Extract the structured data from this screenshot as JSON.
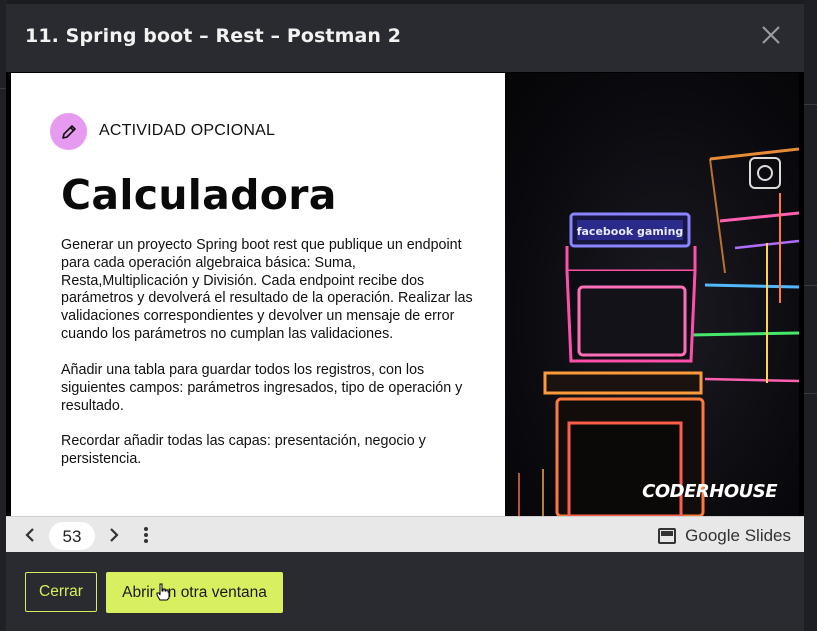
{
  "modal": {
    "title": "11. Spring boot – Rest – Postman 2",
    "close_icon": "close-icon"
  },
  "slide": {
    "activity_icon": "pencil-icon",
    "activity_label": "ACTIVIDAD OPCIONAL",
    "title": "Calculadora",
    "paragraphs": [
      "Generar un proyecto Spring boot rest que publique un endpoint para cada operación algebraica básica: Suma, Resta,Multiplicación y División. Cada endpoint recibe dos parámetros y devolverá el resultado de la operación. Realizar las validaciones correspondientes y devolver un mensaje de error cuando los parámetros no cumplan las validaciones.",
      "Añadir una tabla para guardar todos los registros, con los siguientes campos: parámetros ingresados, tipo de operación y resultado.",
      "Recordar añadir todas las capas: presentación, negocio y persistencia."
    ],
    "image_marquee": "facebook gaming",
    "brand": "CODERHOUSE"
  },
  "toolbar": {
    "page_number": "53",
    "provider_label": "Google Slides",
    "prev_icon": "chevron-left-icon",
    "next_icon": "chevron-right-icon",
    "more_icon": "more-vertical-icon"
  },
  "footer": {
    "close_label": "Cerrar",
    "open_label": "Abrir en otra ventana"
  },
  "colors": {
    "accent": "#d8f05f",
    "modal_bg": "#2a2b30",
    "badge": "#e79bf0"
  }
}
